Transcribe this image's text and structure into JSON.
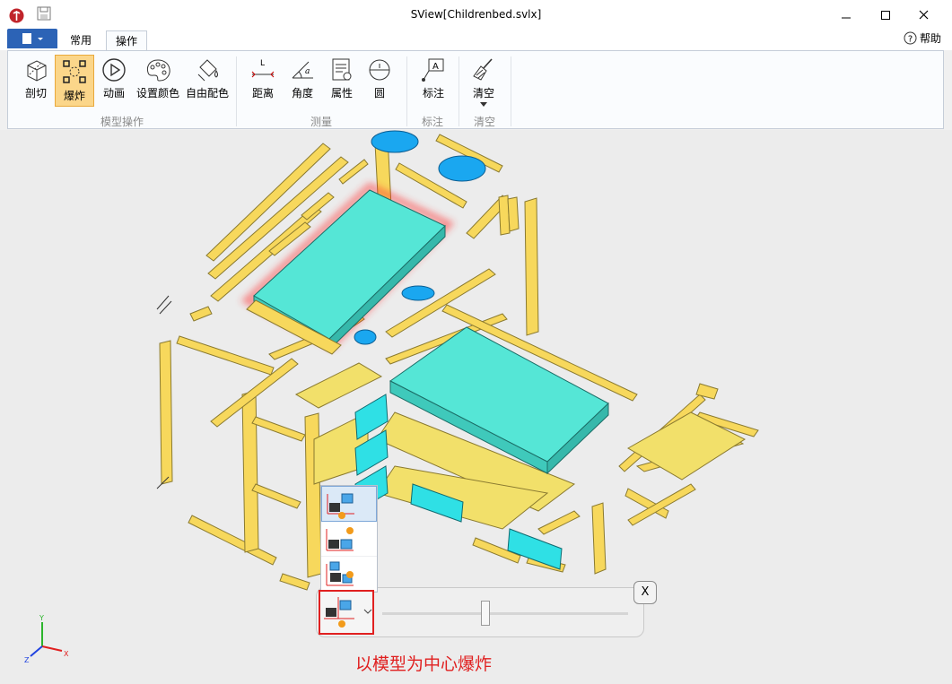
{
  "window": {
    "title": "SView[Childrenbed.svlx]"
  },
  "tabs": [
    {
      "label": "常用"
    },
    {
      "label": "操作"
    }
  ],
  "help": {
    "label": "帮助"
  },
  "ribbon": {
    "model_group": {
      "label": "模型操作",
      "buttons": [
        "剖切",
        "爆炸",
        "动画",
        "设置颜色",
        "自由配色"
      ]
    },
    "measure_group": {
      "label": "测量",
      "buttons": [
        "距离",
        "角度",
        "属性",
        "圆"
      ]
    },
    "annotate_group": {
      "label": "标注",
      "buttons": [
        "标注"
      ]
    },
    "clear_group": {
      "label": "清空",
      "buttons": [
        "清空"
      ]
    }
  },
  "explode": {
    "close_label": "X",
    "slider_value": 0.42,
    "mode_caption": "以模型为中心爆炸"
  },
  "colors": {
    "accent": "#2c63b6",
    "active_button": "#fbd68a",
    "highlight": "#e02020",
    "mattress": "#55e6d6",
    "wood": "#f7d85c",
    "blue_parts": "#1aa7f0"
  }
}
